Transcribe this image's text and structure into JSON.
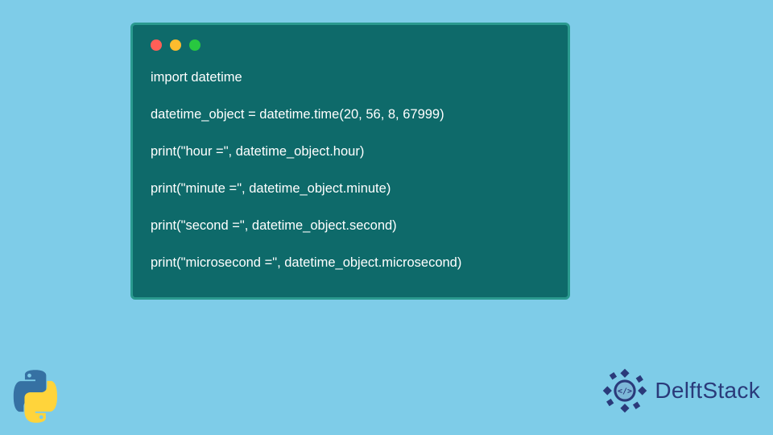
{
  "traffic_colors": {
    "red": "#ff5f57",
    "yellow": "#febc2e",
    "green": "#28c840"
  },
  "card_bg": "#0e6a6a",
  "card_border": "#2a9a8f",
  "code_lines": [
    "import datetime",
    "",
    "datetime_object = datetime.time(20, 56, 8, 67999)",
    "",
    "print(\"hour =\", datetime_object.hour)",
    "",
    "print(\"minute =\", datetime_object.minute)",
    "",
    "print(\"second =\", datetime_object.second)",
    "",
    "print(\"microsecond =\", datetime_object.microsecond)"
  ],
  "brand_text": "DelftStack",
  "brand_color": "#2a3a7a",
  "python_colors": {
    "blue": "#3671a3",
    "yellow": "#ffd43b"
  }
}
